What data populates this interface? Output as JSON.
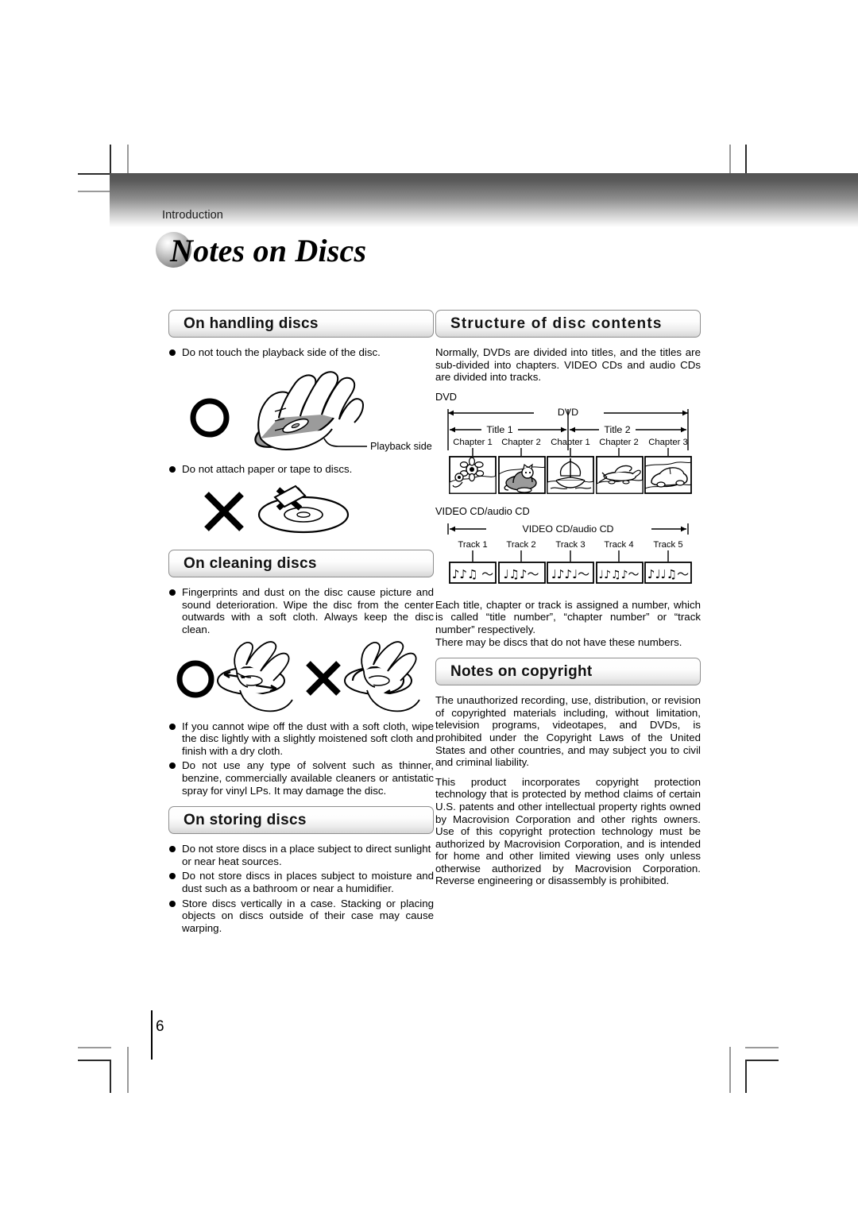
{
  "header": {
    "section_label": "Introduction"
  },
  "page_title": "Notes on Discs",
  "page_number": "6",
  "sections": {
    "handling": {
      "heading": "On handling discs",
      "bullet1": "Do not touch the playback side of the disc.",
      "callout": "Playback side",
      "bullet2": "Do not attach paper or tape to discs."
    },
    "cleaning": {
      "heading": "On cleaning discs",
      "bullet1": "Fingerprints and dust on the disc cause picture and sound deterioration. Wipe the disc from the center outwards with a soft cloth. Always keep the disc clean.",
      "bullet2": "If you cannot wipe off the dust with a soft cloth, wipe the disc lightly with a slightly moistened soft cloth and finish with a dry cloth.",
      "bullet3": "Do not use any type of solvent such as thinner, benzine, commercially available cleaners or antistatic spray for vinyl LPs. It may damage the disc."
    },
    "storing": {
      "heading": "On storing discs",
      "bullet1": "Do not store discs in a place subject to direct sunlight or near heat sources.",
      "bullet2": "Do not store discs in places subject to moisture and dust such as a bathroom or near a humidifier.",
      "bullet3": "Store discs vertically in a case. Stacking or placing objects on discs outside of their case may cause warping."
    },
    "structure": {
      "heading": "Structure of disc contents",
      "intro": "Normally, DVDs are divided into titles, and the titles are sub-divided into chapters. VIDEO CDs and audio CDs are divided into tracks.",
      "dvd_label": "DVD",
      "dvd_span_label": "DVD",
      "title1_label": "Title 1",
      "title2_label": "Title 2",
      "chapters_title1": [
        "Chapter 1",
        "Chapter 2"
      ],
      "chapters_title2": [
        "Chapter 1",
        "Chapter 2",
        "Chapter 3"
      ],
      "thumb_subjects": [
        "sunflower",
        "cat",
        "sailing-ship",
        "airplane",
        "car"
      ],
      "vcd_label": "VIDEO CD/audio CD",
      "vcd_span_label": "VIDEO CD/audio CD",
      "tracks": [
        "Track 1",
        "Track 2",
        "Track 3",
        "Track 4",
        "Track 5"
      ],
      "track_notes": [
        "♪♪♫ 〜",
        "♩♫♪〜",
        "♩♪♪♩〜",
        "♩♪♫♪〜",
        "♪♩♩♫〜"
      ],
      "note1": "Each title, chapter or track is assigned a number, which is called “title number”, “chapter number” or “track number” respectively.",
      "note2": "There may be discs that do not have these numbers."
    },
    "copyright": {
      "heading": "Notes on copyright",
      "para1": "The unauthorized recording, use, distribution, or revision of copyrighted materials including, without limitation, television programs, videotapes, and DVDs, is prohibited under the Copyright Laws of the United States and other countries, and may subject you to civil and criminal liability.",
      "para2": "This product incorporates copyright protection technology that is protected by method claims of certain U.S. patents and other intellectual property rights owned by Macrovision Corporation and other rights owners. Use of this copyright protection technology must be authorized by Macrovision Corporation, and is intended for home and other limited viewing uses only unless otherwise authorized by Macrovision Corporation. Reverse engineering or disassembly is prohibited."
    }
  }
}
